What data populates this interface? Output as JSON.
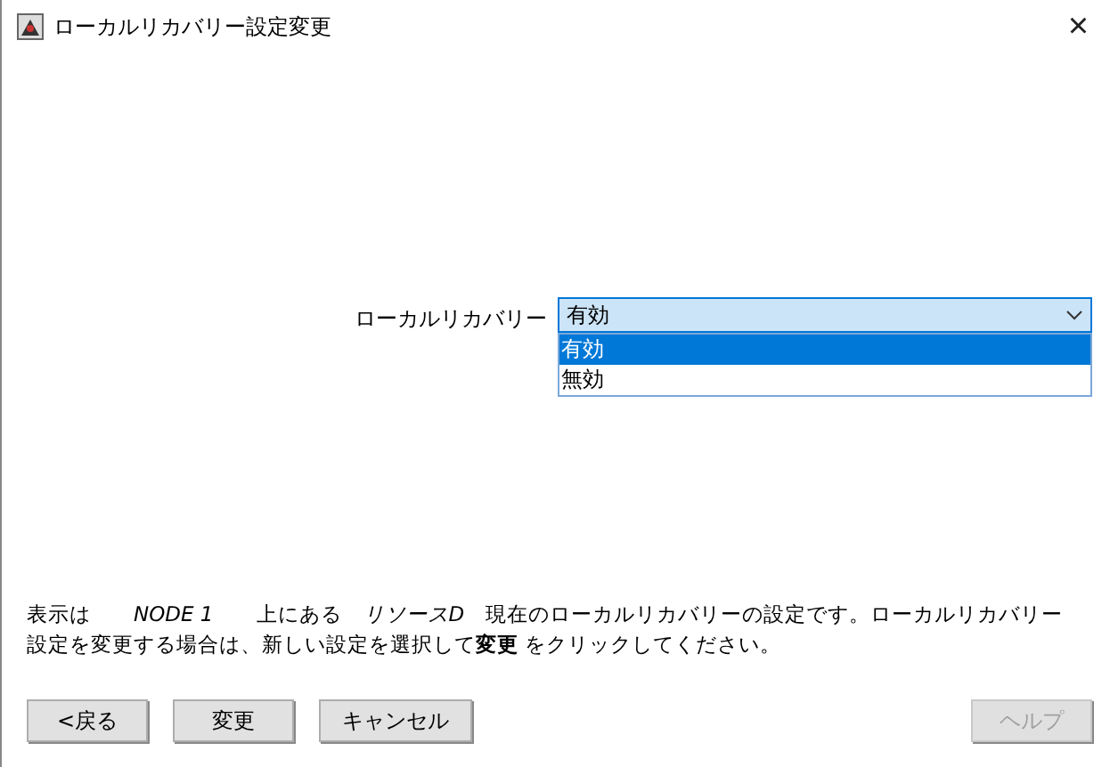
{
  "window": {
    "title": "ローカルリカバリー設定変更",
    "close": "×"
  },
  "setting": {
    "label": "ローカルリカバリー",
    "value": "有効",
    "open": true,
    "options": [
      {
        "label": "有効",
        "selected": true
      },
      {
        "label": "無効",
        "selected": false
      }
    ]
  },
  "description": "表示は　　*NODE 1*　　上にある　*リソースD*　現在のローカルリカバリーの設定です。ローカルリカバリー設定を変更する場合は、新しい設定を選択して**変更** をクリックしてください。",
  "buttons": [
    {
      "label": "<戻る",
      "disabled": false
    },
    {
      "label": "変更",
      "disabled": false
    },
    {
      "label": "キャンセル",
      "disabled": false
    }
  ],
  "help_button": {
    "label": "ヘルプ",
    "disabled": true
  }
}
